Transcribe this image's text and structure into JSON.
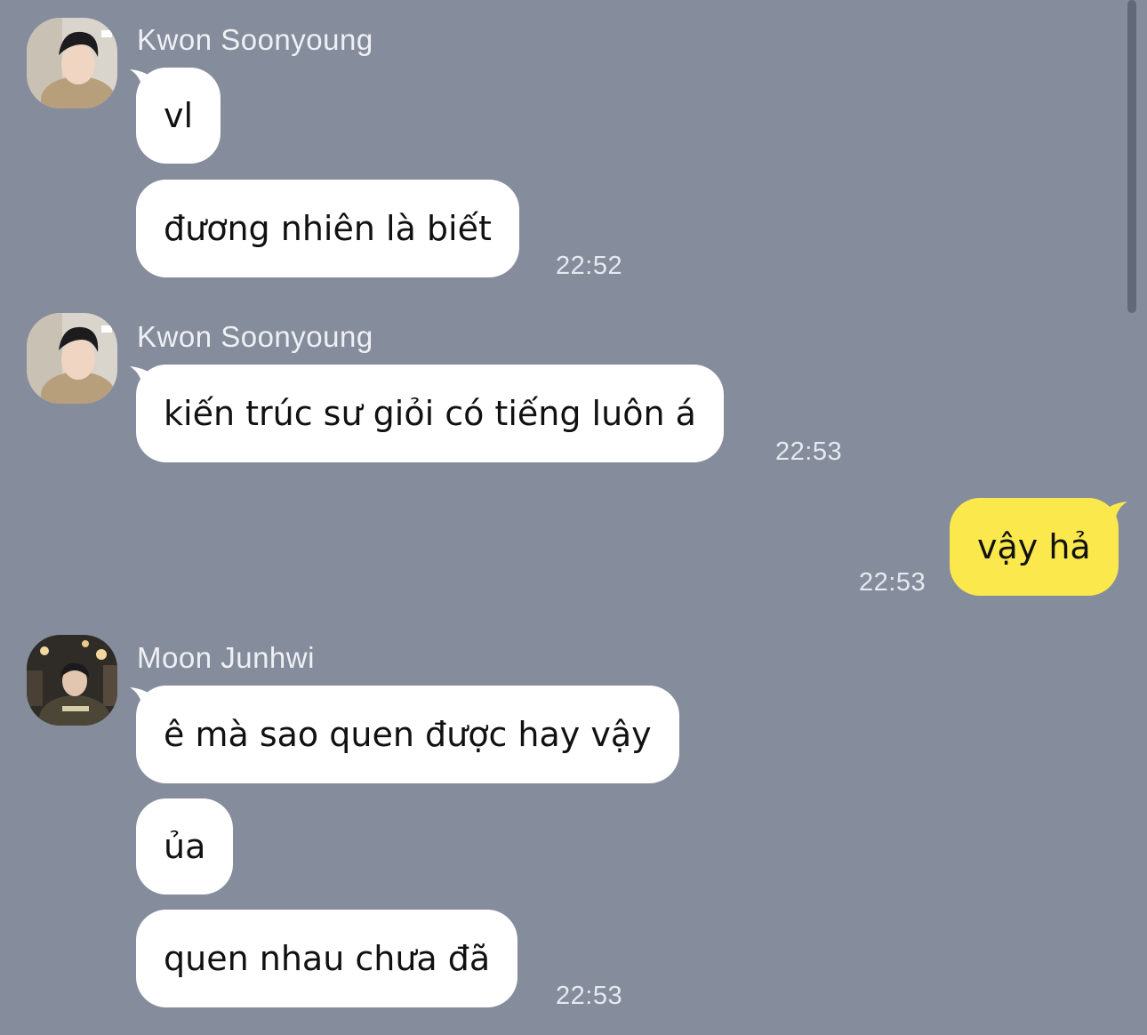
{
  "messages": [
    {
      "sender": "Kwon Soonyoung",
      "avatar": "user-avatar",
      "bubbles": [
        "vl",
        "đương nhiên là biết"
      ],
      "time": "22:52"
    },
    {
      "sender": "Kwon Soonyoung",
      "avatar": "user-avatar",
      "bubbles": [
        "kiến trúc sư giỏi có tiếng luôn á"
      ],
      "time": "22:53"
    },
    {
      "sender": "",
      "mine": true,
      "bubbles": [
        "vậy hả"
      ],
      "time": "22:53"
    },
    {
      "sender": "Moon Junhwi",
      "avatar": "user-avatar",
      "bubbles": [
        "ê mà sao quen được hay vậy",
        "ủa",
        "quen nhau chưa đã"
      ],
      "time": "22:53"
    }
  ],
  "colors": {
    "background": "#858c9c",
    "incoming_bubble": "#ffffff",
    "outgoing_bubble": "#fae84d"
  }
}
